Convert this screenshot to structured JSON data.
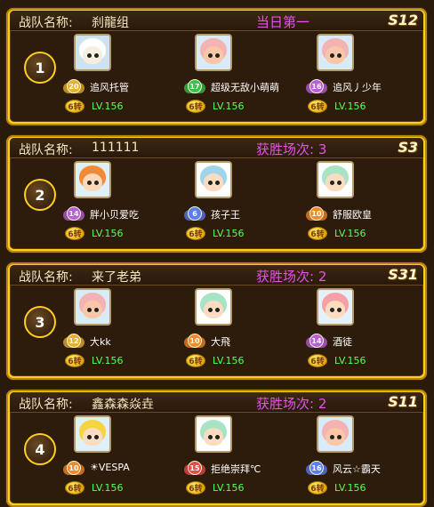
{
  "labels": {
    "team_name_label": "战队名称:",
    "level_prefix": "LV.",
    "turn_suffix": "转"
  },
  "colors": {
    "gold_frame": "#ffcf1c",
    "panel_bg": "#2d1b0c",
    "status_purple": "#e155e3",
    "level_green": "#58ff58",
    "badge_purple": "#b85fd8",
    "badge_blue": "#5a7ef0",
    "badge_orange": "#f08a2a",
    "badge_red": "#e84a4a",
    "badge_green": "#3cbf4a",
    "badge_gold": "#e8b030"
  },
  "teams": [
    {
      "rank": "1",
      "name": "刹龍组",
      "status": "当日第一",
      "server": "S12",
      "members": [
        {
          "name": "追风托管",
          "badge_level": "20",
          "badge_color": "gold",
          "turns": "6转",
          "level": "LV.156",
          "avatar": "white-sheep",
          "avatar_icon": "sheep-hero-avatar-icon"
        },
        {
          "name": "超级无敌小萌萌",
          "badge_level": "17",
          "badge_color": "green",
          "turns": "6转",
          "level": "LV.156",
          "avatar": "pink-sheep",
          "avatar_icon": "pink-sheep-avatar-icon"
        },
        {
          "name": "追风丿少年",
          "badge_level": "16",
          "badge_color": "purple",
          "turns": "6转",
          "level": "LV.156",
          "avatar": "pink-sheep",
          "avatar_icon": "pink-sheep-avatar-icon"
        }
      ]
    },
    {
      "rank": "2",
      "name": "111111",
      "status": "获胜场次: 3",
      "server": "S3",
      "members": [
        {
          "name": "胖小贝爱吃",
          "badge_level": "14",
          "badge_color": "purple",
          "turns": "6转",
          "level": "LV.156",
          "avatar": "orange-hero",
          "avatar_icon": "orange-hair-avatar-icon"
        },
        {
          "name": "孩子王",
          "badge_level": "6",
          "badge_color": "blue",
          "turns": "6转",
          "level": "LV.156",
          "avatar": "blue-hero",
          "avatar_icon": "blue-hair-avatar-icon"
        },
        {
          "name": "舒服欧皇",
          "badge_level": "10",
          "badge_color": "orange",
          "turns": "6转",
          "level": "LV.156",
          "avatar": "green-hero",
          "avatar_icon": "green-hair-avatar-icon"
        }
      ]
    },
    {
      "rank": "3",
      "name": "来了老弟",
      "status": "获胜场次: 2",
      "server": "S31",
      "members": [
        {
          "name": "大kk",
          "badge_level": "12",
          "badge_color": "gold",
          "turns": "6转",
          "level": "LV.156",
          "avatar": "pink-sheep",
          "avatar_icon": "pink-sheep-avatar-icon"
        },
        {
          "name": "大飛",
          "badge_level": "10",
          "badge_color": "orange",
          "turns": "6转",
          "level": "LV.156",
          "avatar": "green-hero",
          "avatar_icon": "green-hair-avatar-icon"
        },
        {
          "name": "酒徒",
          "badge_level": "14",
          "badge_color": "purple",
          "turns": "6转",
          "level": "LV.156",
          "avatar": "pigtail-hero",
          "avatar_icon": "pigtail-girl-avatar-icon"
        }
      ]
    },
    {
      "rank": "4",
      "name": "鑫森森焱垚",
      "status": "获胜场次: 2",
      "server": "S11",
      "members": [
        {
          "name": "☀VESPA",
          "badge_level": "10",
          "badge_color": "orange",
          "turns": "6转",
          "level": "LV.156",
          "avatar": "yellow-hero",
          "avatar_icon": "yellow-hair-avatar-icon"
        },
        {
          "name": "拒绝崇拜℃",
          "badge_level": "15",
          "badge_color": "red",
          "turns": "6转",
          "level": "LV.156",
          "avatar": "green-hero",
          "avatar_icon": "green-hair-avatar-icon"
        },
        {
          "name": "风云☆霸天",
          "badge_level": "16",
          "badge_color": "blue",
          "turns": "6转",
          "level": "LV.156",
          "avatar": "pink-sheep",
          "avatar_icon": "pink-sheep-avatar-icon"
        }
      ]
    }
  ]
}
